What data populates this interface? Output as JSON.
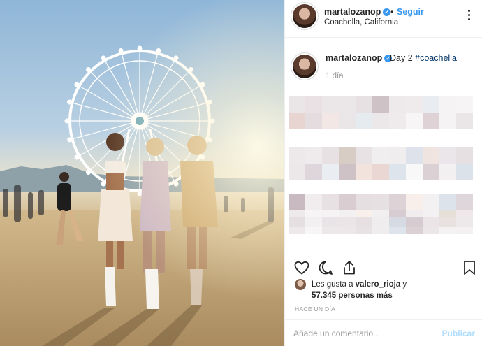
{
  "post": {
    "username": "martalozanop",
    "verified_glyph": "✓",
    "dot": "•",
    "follow_label": "Seguir",
    "location": "Coachella, California",
    "more_icon": "ellipsis-vertical-icon"
  },
  "caption": {
    "username": "martalozanop",
    "text": "Day 2 ",
    "hashtag": "#coachella",
    "time": "1 día"
  },
  "actions": {
    "like_icon": "heart-icon",
    "comment_icon": "comment-icon",
    "share_icon": "share-icon",
    "save_icon": "bookmark-icon"
  },
  "likes": {
    "prefix": "Les gusta a ",
    "user": "valero_rioja",
    "joiner": " y",
    "count": "57.345 personas más"
  },
  "posted_ago": "HACE UN DÍA",
  "comment": {
    "placeholder": "Añade un comentario...",
    "publish_label": "Publicar"
  },
  "colors": {
    "accent": "#3897f0",
    "publish_disabled": "#b2dffc",
    "hashtag": "#003569"
  }
}
